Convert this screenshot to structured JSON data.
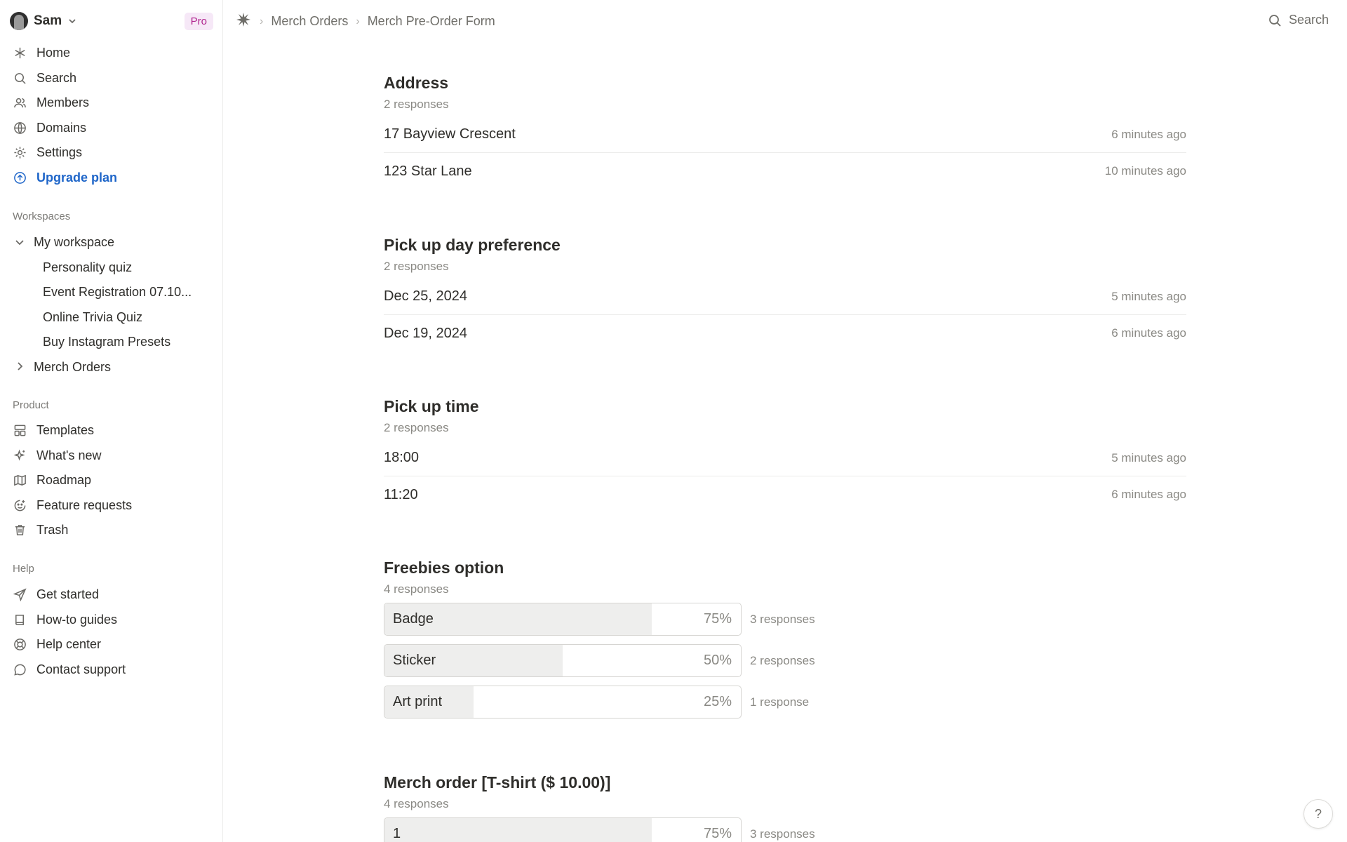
{
  "sidebar": {
    "user": {
      "name": "Sam",
      "badge": "Pro"
    },
    "nav": [
      {
        "label": "Home",
        "icon": "asterisk-icon"
      },
      {
        "label": "Search",
        "icon": "search-icon"
      },
      {
        "label": "Members",
        "icon": "members-icon"
      },
      {
        "label": "Domains",
        "icon": "globe-icon"
      },
      {
        "label": "Settings",
        "icon": "gear-icon"
      },
      {
        "label": "Upgrade plan",
        "icon": "upgrade-icon"
      }
    ],
    "workspaces_label": "Workspaces",
    "workspace": {
      "name": "My workspace",
      "items": [
        "Personality quiz",
        "Event Registration 07.10...",
        "Online Trivia Quiz",
        "Buy Instagram Presets"
      ],
      "collapsed": "Merch Orders"
    },
    "product_label": "Product",
    "product": [
      {
        "label": "Templates",
        "icon": "templates-icon"
      },
      {
        "label": "What's new",
        "icon": "sparkle-icon"
      },
      {
        "label": "Roadmap",
        "icon": "map-icon"
      },
      {
        "label": "Feature requests",
        "icon": "feature-request-icon"
      },
      {
        "label": "Trash",
        "icon": "trash-icon"
      }
    ],
    "help_label": "Help",
    "help": [
      {
        "label": "Get started",
        "icon": "send-icon"
      },
      {
        "label": "How-to guides",
        "icon": "book-icon"
      },
      {
        "label": "Help center",
        "icon": "lifebuoy-icon"
      },
      {
        "label": "Contact support",
        "icon": "chat-icon"
      }
    ]
  },
  "topbar": {
    "crumbs": [
      "Merch Orders",
      "Merch Pre-Order Form"
    ],
    "search": "Search"
  },
  "questions": {
    "address": {
      "title": "Address",
      "count": "2 responses",
      "rows": [
        {
          "value": "17 Bayview Crescent",
          "time": "6 minutes ago"
        },
        {
          "value": "123 Star Lane",
          "time": "10 minutes ago"
        }
      ]
    },
    "pickup_day": {
      "title": "Pick up day preference",
      "count": "2 responses",
      "rows": [
        {
          "value": "Dec 25, 2024",
          "time": "5 minutes ago"
        },
        {
          "value": "Dec 19, 2024",
          "time": "6 minutes ago"
        }
      ]
    },
    "pickup_time": {
      "title": "Pick up time",
      "count": "2 responses",
      "rows": [
        {
          "value": "18:00",
          "time": "5 minutes ago"
        },
        {
          "value": "11:20",
          "time": "6 minutes ago"
        }
      ]
    },
    "freebies": {
      "title": "Freebies option",
      "count": "4 responses",
      "options": [
        {
          "label": "Badge",
          "pct": "75%",
          "fraction": 0.75,
          "count": "3 responses"
        },
        {
          "label": "Sticker",
          "pct": "50%",
          "fraction": 0.5,
          "count": "2 responses"
        },
        {
          "label": "Art print",
          "pct": "25%",
          "fraction": 0.25,
          "count": "1 response"
        }
      ]
    },
    "merch": {
      "title": "Merch order [T-shirt ($ 10.00)]",
      "count": "4 responses",
      "options": [
        {
          "label": "1",
          "pct": "75%",
          "fraction": 0.75,
          "count": "3 responses"
        }
      ]
    }
  },
  "help_button": "?"
}
